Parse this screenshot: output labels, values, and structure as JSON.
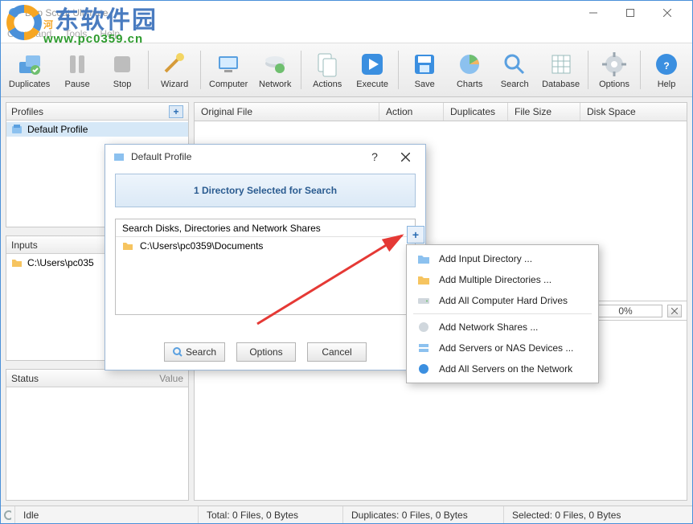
{
  "window": {
    "title": "Dup Scout Ultimate"
  },
  "menu": {
    "items": [
      "Command",
      "Tools",
      "Help"
    ]
  },
  "toolbar": {
    "duplicates": "Duplicates",
    "pause": "Pause",
    "stop": "Stop",
    "wizard": "Wizard",
    "computer": "Computer",
    "network": "Network",
    "actions": "Actions",
    "execute": "Execute",
    "save": "Save",
    "charts": "Charts",
    "search": "Search",
    "database": "Database",
    "options": "Options",
    "help": "Help"
  },
  "panels": {
    "profiles": {
      "title": "Profiles",
      "items": [
        "Default Profile"
      ],
      "selected": 0
    },
    "inputs": {
      "title": "Inputs",
      "items": [
        "C:\\Users\\pc035"
      ]
    },
    "status": {
      "title": "Status",
      "value_label": "Value"
    }
  },
  "grid": {
    "cols": [
      "Original File",
      "Action",
      "Duplicates",
      "File Size",
      "Disk Space"
    ]
  },
  "progress": "0%",
  "statusbar": {
    "state": "Idle",
    "total": "Total: 0 Files, 0 Bytes",
    "dup": "Duplicates: 0 Files, 0 Bytes",
    "sel": "Selected: 0 Files, 0 Bytes"
  },
  "dialog": {
    "title": "Default Profile",
    "banner": "1 Directory Selected for Search",
    "list_head": "Search Disks, Directories and Network Shares",
    "list_item": "C:\\Users\\pc0359\\Documents",
    "btn_search": "Search",
    "btn_options": "Options",
    "btn_cancel": "Cancel"
  },
  "ctx": {
    "add_dir": "Add Input Directory ...",
    "add_multi": "Add Multiple Directories ...",
    "add_drives": "Add All Computer Hard Drives",
    "add_shares": "Add Network Shares ...",
    "add_servers": "Add Servers or NAS Devices ...",
    "add_all_net": "Add All Servers on the Network"
  },
  "watermark": {
    "brand_cn": "河东软件园",
    "url": "www.pc0359.cn"
  }
}
